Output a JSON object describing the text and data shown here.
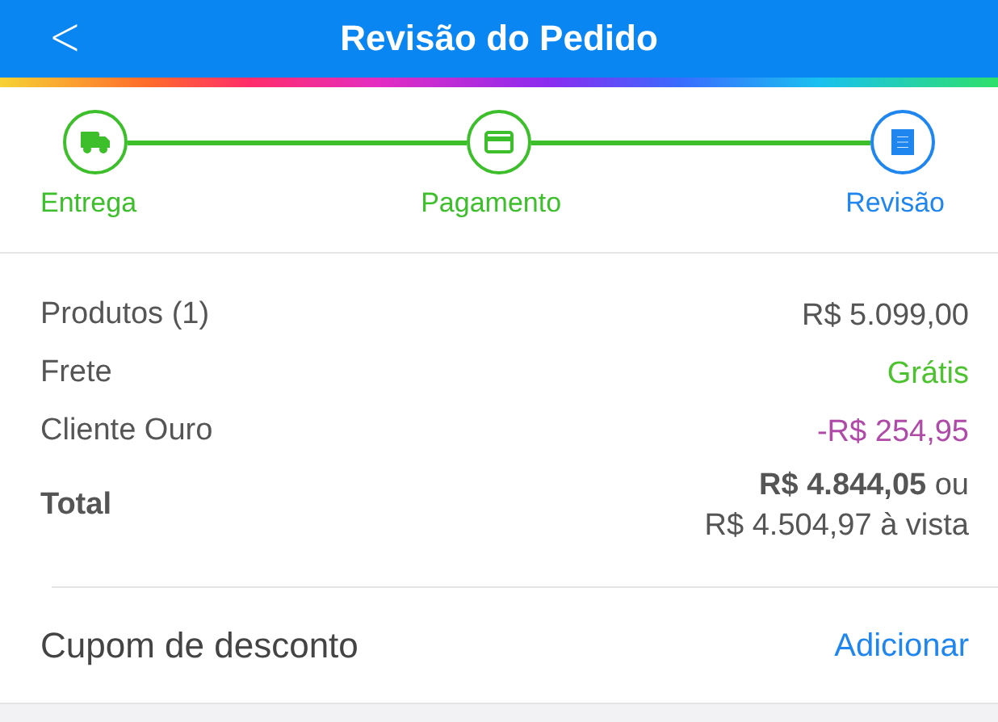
{
  "header": {
    "back": "<",
    "title": "Revisão do Pedido"
  },
  "steps": [
    {
      "label": "Entrega",
      "selected": false
    },
    {
      "label": "Pagamento",
      "selected": false
    },
    {
      "label": "Revisão",
      "selected": true
    }
  ],
  "summary": [
    {
      "label": "Produtos (1)",
      "value": "R$ 5.099,00",
      "kind": "plain"
    },
    {
      "label": "Frete",
      "value": "Grátis",
      "kind": "free"
    },
    {
      "label": "Cliente Ouro",
      "value": "-R$ 254,95",
      "kind": "discount"
    },
    {
      "label": "Total",
      "value": "**R$ 4.844,05** ou",
      "note": "R$ 4.504,97 à vista",
      "kind": "total"
    }
  ],
  "coupon": {
    "label": "Cupom de desconto",
    "action": "Adicionar"
  }
}
